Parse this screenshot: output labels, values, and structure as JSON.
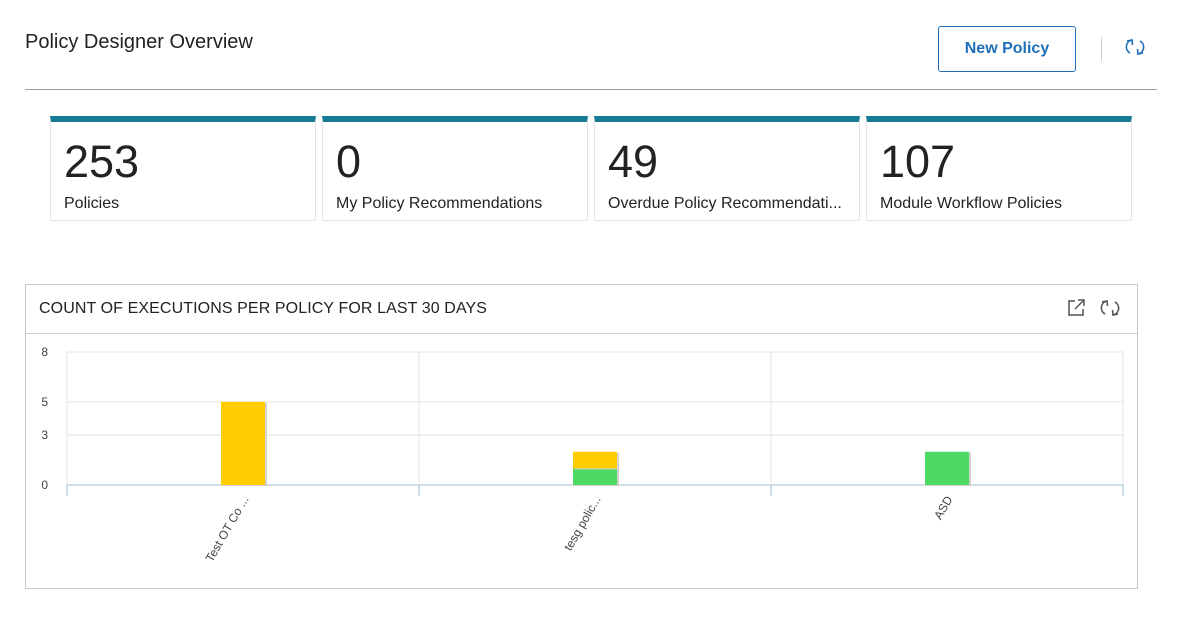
{
  "header": {
    "title": "Policy Designer Overview",
    "new_policy_label": "New Policy",
    "refresh_icon": "refresh-icon"
  },
  "cards": [
    {
      "value": "253",
      "label": "Policies"
    },
    {
      "value": "0",
      "label": "My Policy Recommendations"
    },
    {
      "value": "49",
      "label": "Overdue Policy Recommendati..."
    },
    {
      "value": "107",
      "label": "Module Workflow Policies"
    }
  ],
  "colors": {
    "accent": "#177c95",
    "button": "#1f6fb8",
    "bar_yellow": "#ffcc00",
    "bar_green": "#4cd964"
  },
  "widget": {
    "title": "COUNT OF EXECUTIONS PER POLICY FOR LAST 30 DAYS",
    "icons": [
      "popout-icon",
      "refresh-icon"
    ]
  },
  "chart_data": {
    "type": "bar",
    "stacked": true,
    "categories": [
      "Test OT Co ...",
      "tesg polic...",
      "ASD"
    ],
    "series": [
      {
        "color": "#4cd964",
        "values": [
          0,
          1,
          2
        ]
      },
      {
        "color": "#ffcc00",
        "values": [
          5,
          1,
          0
        ]
      }
    ],
    "yticks": [
      "8",
      "5",
      "3",
      "0"
    ],
    "ylim": [
      0,
      8
    ],
    "grid": true
  }
}
